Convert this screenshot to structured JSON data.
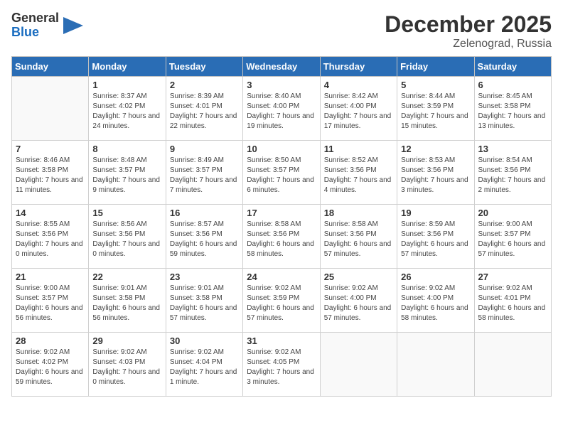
{
  "header": {
    "logo": {
      "general": "General",
      "blue": "Blue",
      "icon": "▶"
    },
    "month": "December 2025",
    "location": "Zelenograd, Russia"
  },
  "weekdays": [
    "Sunday",
    "Monday",
    "Tuesday",
    "Wednesday",
    "Thursday",
    "Friday",
    "Saturday"
  ],
  "weeks": [
    [
      {
        "day": null
      },
      {
        "day": "1",
        "sunrise": "8:37 AM",
        "sunset": "4:02 PM",
        "daylight": "7 hours and 24 minutes."
      },
      {
        "day": "2",
        "sunrise": "8:39 AM",
        "sunset": "4:01 PM",
        "daylight": "7 hours and 22 minutes."
      },
      {
        "day": "3",
        "sunrise": "8:40 AM",
        "sunset": "4:00 PM",
        "daylight": "7 hours and 19 minutes."
      },
      {
        "day": "4",
        "sunrise": "8:42 AM",
        "sunset": "4:00 PM",
        "daylight": "7 hours and 17 minutes."
      },
      {
        "day": "5",
        "sunrise": "8:44 AM",
        "sunset": "3:59 PM",
        "daylight": "7 hours and 15 minutes."
      },
      {
        "day": "6",
        "sunrise": "8:45 AM",
        "sunset": "3:58 PM",
        "daylight": "7 hours and 13 minutes."
      }
    ],
    [
      {
        "day": "7",
        "sunrise": "8:46 AM",
        "sunset": "3:58 PM",
        "daylight": "7 hours and 11 minutes."
      },
      {
        "day": "8",
        "sunrise": "8:48 AM",
        "sunset": "3:57 PM",
        "daylight": "7 hours and 9 minutes."
      },
      {
        "day": "9",
        "sunrise": "8:49 AM",
        "sunset": "3:57 PM",
        "daylight": "7 hours and 7 minutes."
      },
      {
        "day": "10",
        "sunrise": "8:50 AM",
        "sunset": "3:57 PM",
        "daylight": "7 hours and 6 minutes."
      },
      {
        "day": "11",
        "sunrise": "8:52 AM",
        "sunset": "3:56 PM",
        "daylight": "7 hours and 4 minutes."
      },
      {
        "day": "12",
        "sunrise": "8:53 AM",
        "sunset": "3:56 PM",
        "daylight": "7 hours and 3 minutes."
      },
      {
        "day": "13",
        "sunrise": "8:54 AM",
        "sunset": "3:56 PM",
        "daylight": "7 hours and 2 minutes."
      }
    ],
    [
      {
        "day": "14",
        "sunrise": "8:55 AM",
        "sunset": "3:56 PM",
        "daylight": "7 hours and 0 minutes."
      },
      {
        "day": "15",
        "sunrise": "8:56 AM",
        "sunset": "3:56 PM",
        "daylight": "7 hours and 0 minutes."
      },
      {
        "day": "16",
        "sunrise": "8:57 AM",
        "sunset": "3:56 PM",
        "daylight": "6 hours and 59 minutes."
      },
      {
        "day": "17",
        "sunrise": "8:58 AM",
        "sunset": "3:56 PM",
        "daylight": "6 hours and 58 minutes."
      },
      {
        "day": "18",
        "sunrise": "8:58 AM",
        "sunset": "3:56 PM",
        "daylight": "6 hours and 57 minutes."
      },
      {
        "day": "19",
        "sunrise": "8:59 AM",
        "sunset": "3:56 PM",
        "daylight": "6 hours and 57 minutes."
      },
      {
        "day": "20",
        "sunrise": "9:00 AM",
        "sunset": "3:57 PM",
        "daylight": "6 hours and 57 minutes."
      }
    ],
    [
      {
        "day": "21",
        "sunrise": "9:00 AM",
        "sunset": "3:57 PM",
        "daylight": "6 hours and 56 minutes."
      },
      {
        "day": "22",
        "sunrise": "9:01 AM",
        "sunset": "3:58 PM",
        "daylight": "6 hours and 56 minutes."
      },
      {
        "day": "23",
        "sunrise": "9:01 AM",
        "sunset": "3:58 PM",
        "daylight": "6 hours and 57 minutes."
      },
      {
        "day": "24",
        "sunrise": "9:02 AM",
        "sunset": "3:59 PM",
        "daylight": "6 hours and 57 minutes."
      },
      {
        "day": "25",
        "sunrise": "9:02 AM",
        "sunset": "4:00 PM",
        "daylight": "6 hours and 57 minutes."
      },
      {
        "day": "26",
        "sunrise": "9:02 AM",
        "sunset": "4:00 PM",
        "daylight": "6 hours and 58 minutes."
      },
      {
        "day": "27",
        "sunrise": "9:02 AM",
        "sunset": "4:01 PM",
        "daylight": "6 hours and 58 minutes."
      }
    ],
    [
      {
        "day": "28",
        "sunrise": "9:02 AM",
        "sunset": "4:02 PM",
        "daylight": "6 hours and 59 minutes."
      },
      {
        "day": "29",
        "sunrise": "9:02 AM",
        "sunset": "4:03 PM",
        "daylight": "7 hours and 0 minutes."
      },
      {
        "day": "30",
        "sunrise": "9:02 AM",
        "sunset": "4:04 PM",
        "daylight": "7 hours and 1 minute."
      },
      {
        "day": "31",
        "sunrise": "9:02 AM",
        "sunset": "4:05 PM",
        "daylight": "7 hours and 3 minutes."
      },
      {
        "day": null
      },
      {
        "day": null
      },
      {
        "day": null
      }
    ]
  ]
}
